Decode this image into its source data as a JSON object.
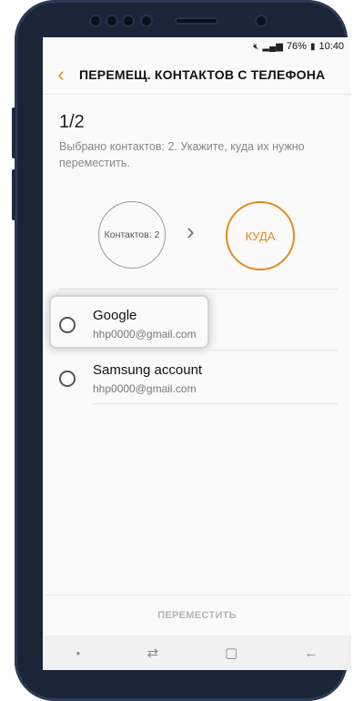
{
  "status_bar": {
    "mute_icon": "mute-icon",
    "signal_icon": "signal-icon",
    "battery_percent": "76%",
    "battery_icon": "battery-icon",
    "time": "10:40"
  },
  "app_bar": {
    "back_icon": "back-arrow-icon",
    "title": "ПЕРЕМЕЩ. КОНТАКТОВ С ТЕЛЕФОНА"
  },
  "step": "1/2",
  "description": "Выбрано контактов: 2. Укажите, куда их нужно переместить.",
  "flow": {
    "source_label": "Контактов: 2",
    "target_label": "КУДА",
    "arrow_icon": "chevron-right-icon"
  },
  "accounts": [
    {
      "name": "Google",
      "email": "hhp0000@gmail.com",
      "selected": false
    },
    {
      "name": "Samsung account",
      "email": "hhp0000@gmail.com",
      "selected": false
    }
  ],
  "footer": {
    "move_label": "ПЕРЕМЕСТИТЬ"
  },
  "nav": {
    "dot_icon": "dot-icon",
    "recents_icon": "recents-icon",
    "home_icon": "home-icon",
    "back_icon": "nav-back-icon"
  },
  "colors": {
    "accent": "#e88a1a",
    "phone_body": "#1b2538"
  }
}
